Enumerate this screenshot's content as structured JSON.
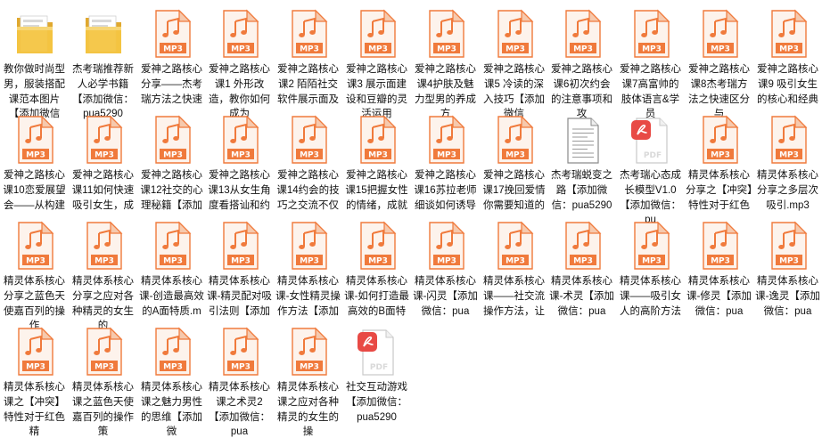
{
  "window": {
    "view": "large-icons"
  },
  "icon_types": {
    "folder": "folder-icon",
    "mp3": "mp3-file-icon",
    "txt": "text-document-icon",
    "pdf": "pdf-file-icon"
  },
  "colors": {
    "mp3_accent": "#f07a3c",
    "folder_yellow": "#f4c542",
    "pdf_red": "#e84a45"
  },
  "files": [
    {
      "type": "folder",
      "label": "教你做时尚型男，服装搭配课范本图片【添加微信"
    },
    {
      "type": "folder",
      "label": "杰考瑞推荐新人必学书籍【添加微信：pua5290"
    },
    {
      "type": "mp3",
      "label": "爱神之路核心分享——杰考瑞方法之快速"
    },
    {
      "type": "mp3",
      "label": "爱神之路核心课1 外形改造，教你如何成为"
    },
    {
      "type": "mp3",
      "label": "爱神之路核心课2 陌陌社交软件展示面及"
    },
    {
      "type": "mp3",
      "label": "爱神之路核心课3 展示面建设和豆瓣的灵活运用"
    },
    {
      "type": "mp3",
      "label": "爱神之路核心课4护肤及魅力型男的养成方"
    },
    {
      "type": "mp3",
      "label": "爱神之路核心课5 冷读的深入技巧【添加微信"
    },
    {
      "type": "mp3",
      "label": "爱神之路核心课6初次约会的注意事项和攻"
    },
    {
      "type": "mp3",
      "label": "爱神之路核心课7高富帅的肢体语言&学员"
    },
    {
      "type": "mp3",
      "label": "爱神之路核心课8杰考瑞方法之快速区分与"
    },
    {
      "type": "mp3",
      "label": "爱神之路核心课9 吸引女生的核心和经典"
    },
    {
      "type": "mp3",
      "label": "爱神之路核心课10恋爱展望会——从构建"
    },
    {
      "type": "mp3",
      "label": "爱神之路核心课11如何快速吸引女生，成"
    },
    {
      "type": "mp3",
      "label": "爱神之路核心课12社交的心理秘籍【添加"
    },
    {
      "type": "mp3",
      "label": "爱神之路核心课13从女生角度看搭讪和约"
    },
    {
      "type": "mp3",
      "label": "爱神之路核心课14约会的技巧之交流不仅"
    },
    {
      "type": "mp3",
      "label": "爱神之路核心课15把握女性的情绪，成就"
    },
    {
      "type": "mp3",
      "label": "爱神之路核心课16苏拉老师细谈如何诱导"
    },
    {
      "type": "mp3",
      "label": "爱神之路核心课17挽回爱情你需要知道的"
    },
    {
      "type": "txt",
      "label": "杰考瑞蜕变之路【添加微信：pua5290"
    },
    {
      "type": "pdf",
      "label": "杰考瑞心态成长模型V1.0【添加微信：pu"
    },
    {
      "type": "mp3",
      "label": "精灵体系核心分享之【冲突】特性对于红色"
    },
    {
      "type": "mp3",
      "label": "精灵体系核心分享之多层次吸引.mp3"
    },
    {
      "type": "mp3",
      "label": "精灵体系核心分享之蓝色天使嘉百列的操作"
    },
    {
      "type": "mp3",
      "label": "精灵体系核心分享之应对各种精灵的女生的"
    },
    {
      "type": "mp3",
      "label": "精灵体系核心课-创造最高效的A面特质.m"
    },
    {
      "type": "mp3",
      "label": "精灵体系核心课-精灵配对吸引法则【添加"
    },
    {
      "type": "mp3",
      "label": "精灵体系核心课-女性精灵操作方法【添加"
    },
    {
      "type": "mp3",
      "label": "精灵体系核心课-如何打造最高效的B面特"
    },
    {
      "type": "mp3",
      "label": "精灵体系核心课-闪灵【添加微信：pua"
    },
    {
      "type": "mp3",
      "label": "精灵体系核心课——社交流操作方法，让"
    },
    {
      "type": "mp3",
      "label": "精灵体系核心课-术灵【添加微信：pua"
    },
    {
      "type": "mp3",
      "label": "精灵体系核心课——吸引女人的高阶方法"
    },
    {
      "type": "mp3",
      "label": "精灵体系核心课-修灵【添加微信：pua"
    },
    {
      "type": "mp3",
      "label": "精灵体系核心课-逸灵【添加微信：pua"
    },
    {
      "type": "mp3",
      "label": "精灵体系核心课之【冲突】特性对于红色精"
    },
    {
      "type": "mp3",
      "label": "精灵体系核心课之蓝色天使嘉百列的操作策"
    },
    {
      "type": "mp3",
      "label": "精灵体系核心课之魅力男性的思维【添加微"
    },
    {
      "type": "mp3",
      "label": "精灵体系核心课之术灵2【添加微信：pua"
    },
    {
      "type": "mp3",
      "label": "精灵体系核心课之应对各种精灵的女生的操"
    },
    {
      "type": "pdf",
      "label": "社交互动游戏【添加微信：pua5290"
    }
  ]
}
